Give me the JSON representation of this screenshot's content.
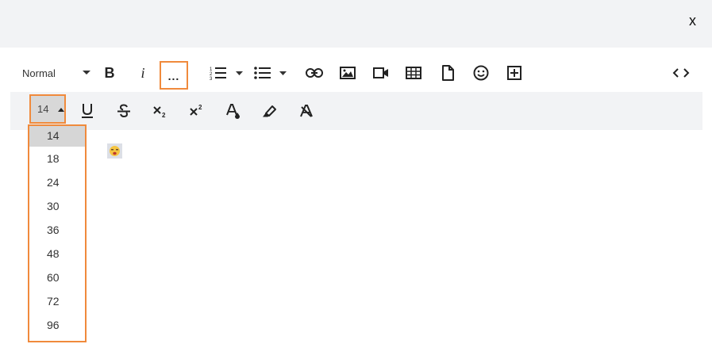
{
  "dialog": {
    "close_label": "x"
  },
  "toolbar": {
    "format_label": "Normal",
    "bold_label": "B",
    "italic_label": "i",
    "more_label": "..."
  },
  "font_size": {
    "current": "14",
    "options": [
      "14",
      "18",
      "24",
      "30",
      "36",
      "48",
      "60",
      "72",
      "96"
    ]
  },
  "icons": [
    "chevron-down-icon",
    "ordered-list-icon",
    "bullet-list-icon",
    "link-icon",
    "image-icon",
    "video-icon",
    "table-icon",
    "file-icon",
    "emoji-icon",
    "add-box-icon",
    "code-view-icon",
    "underline-icon",
    "strikethrough-icon",
    "subscript-icon",
    "superscript-icon",
    "font-color-icon",
    "highlight-icon",
    "clear-format-icon"
  ],
  "colors": {
    "highlight_border": "#f08a3c",
    "toolbar_bg": "#f2f3f5",
    "selected_bg": "#d6d6d6"
  }
}
